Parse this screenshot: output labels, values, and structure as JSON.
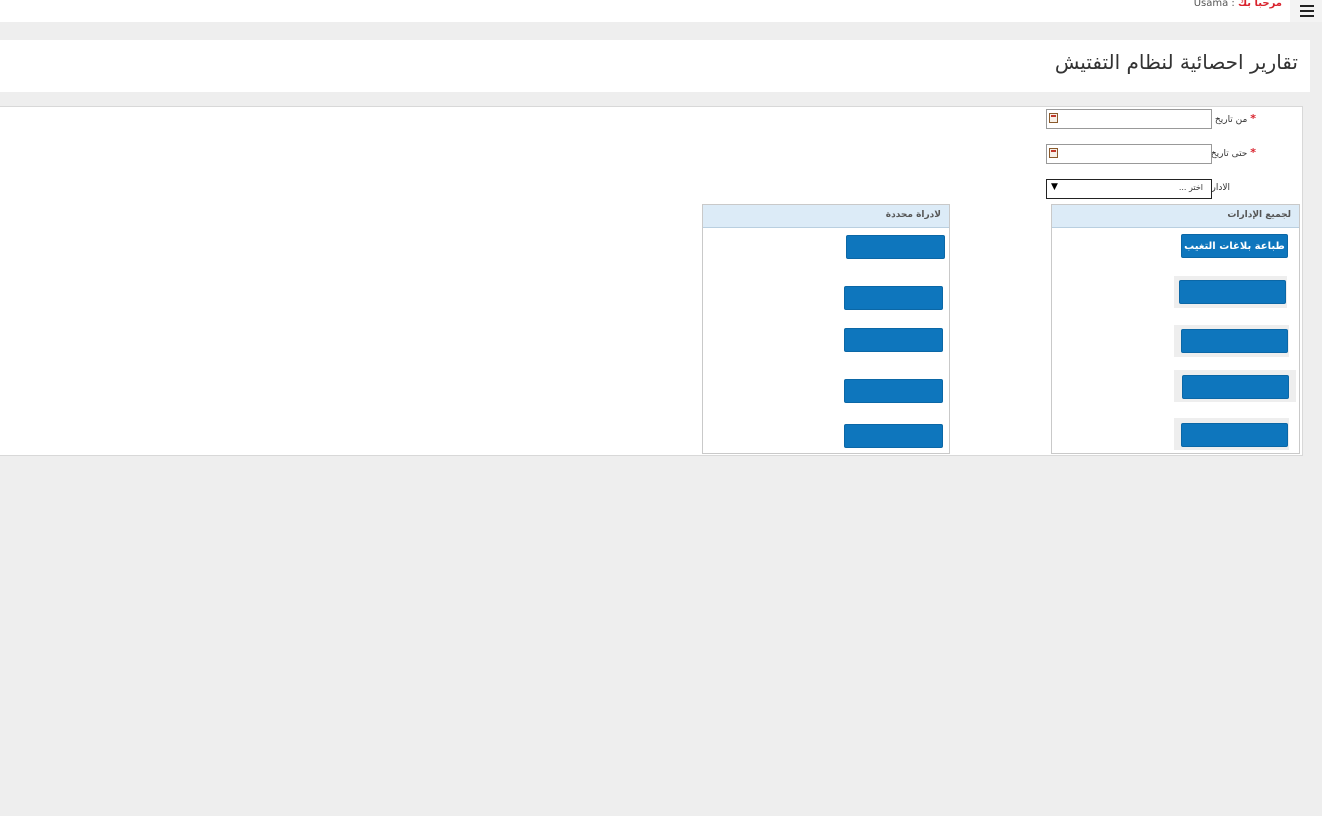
{
  "header": {
    "welcome_greeting": "مرحبا بك",
    "welcome_separator": ":",
    "username": "Usama"
  },
  "page": {
    "title": "تقارير احصائية لنظام  التفتيش"
  },
  "form": {
    "from_date": {
      "label": "من تاريخ",
      "required_mark": "*",
      "value": ""
    },
    "to_date": {
      "label": "حتى تاريخ",
      "required_mark": "*",
      "value": ""
    },
    "department": {
      "label": "الادارة",
      "selected": "اختر ..."
    }
  },
  "all_departments_panel": {
    "title": "لجميع الإدارات",
    "buttons": [
      {
        "label": "طباعة بلاغات التغيب"
      },
      {
        "label": ""
      },
      {
        "label": ""
      },
      {
        "label": ""
      },
      {
        "label": ""
      }
    ]
  },
  "specific_department_panel": {
    "title": "لادراة محددة",
    "buttons": [
      {
        "label": ""
      },
      {
        "label": ""
      },
      {
        "label": ""
      },
      {
        "label": ""
      },
      {
        "label": ""
      }
    ]
  },
  "colors": {
    "accent_button": "#0e76bd",
    "panel_header": "#dcebf7",
    "required": "#d9232d",
    "page_background": "#eeeeee"
  },
  "icons": {
    "menu": "hamburger-menu-icon",
    "calendar": "calendar-icon",
    "dropdown": "dropdown-arrow-icon"
  }
}
